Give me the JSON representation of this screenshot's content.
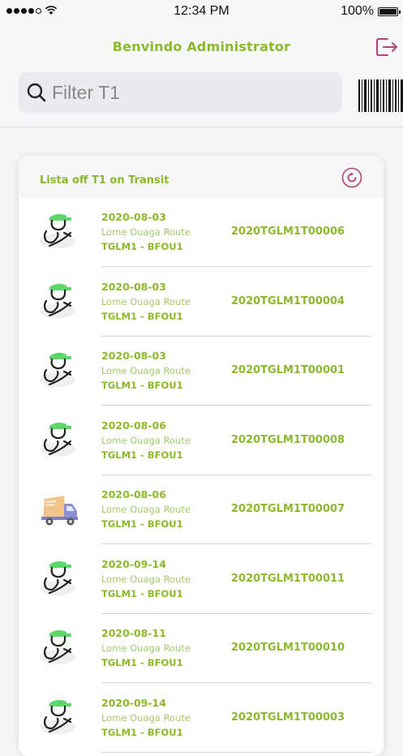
{
  "status_bar": {
    "time": "12:34 PM",
    "battery": "100%"
  },
  "header": {
    "title": "Benvindo Administrator"
  },
  "search": {
    "placeholder": "Filter T1"
  },
  "list": {
    "title": "Lista off T1 on Transit",
    "items": [
      {
        "date": "2020-08-03",
        "route": "Lome Ouaga Route",
        "code": "TGLM1 - BFOU1",
        "id": "2020TGLM1T00006",
        "icon": "driver-icon"
      },
      {
        "date": "2020-08-03",
        "route": "Lome Ouaga Route",
        "code": "TGLM1 - BFOU1",
        "id": "2020TGLM1T00004",
        "icon": "driver-icon"
      },
      {
        "date": "2020-08-03",
        "route": "Lome Ouaga Route",
        "code": "TGLM1 - BFOU1",
        "id": "2020TGLM1T00001",
        "icon": "driver-icon"
      },
      {
        "date": "2020-08-06",
        "route": "Lome Ouaga Route",
        "code": "TGLM1 - BFOU1",
        "id": "2020TGLM1T00008",
        "icon": "driver-icon"
      },
      {
        "date": "2020-08-06",
        "route": "Lome Ouaga Route",
        "code": "TGLM1 - BFOU1",
        "id": "2020TGLM1T00007",
        "icon": "truck-icon"
      },
      {
        "date": "2020-09-14",
        "route": "Lome Ouaga Route",
        "code": "TGLM1 - BFOU1",
        "id": "2020TGLM1T00011",
        "icon": "driver-icon"
      },
      {
        "date": "2020-08-11",
        "route": "Lome Ouaga Route",
        "code": "TGLM1 - BFOU1",
        "id": "2020TGLM1T00010",
        "icon": "driver-icon"
      },
      {
        "date": "2020-09-14",
        "route": "Lome Ouaga Route",
        "code": "TGLM1 - BFOU1",
        "id": "2020TGLM1T00003",
        "icon": "driver-icon"
      }
    ]
  },
  "colors": {
    "accent": "#8cb82a",
    "logout": "#b0447a"
  }
}
